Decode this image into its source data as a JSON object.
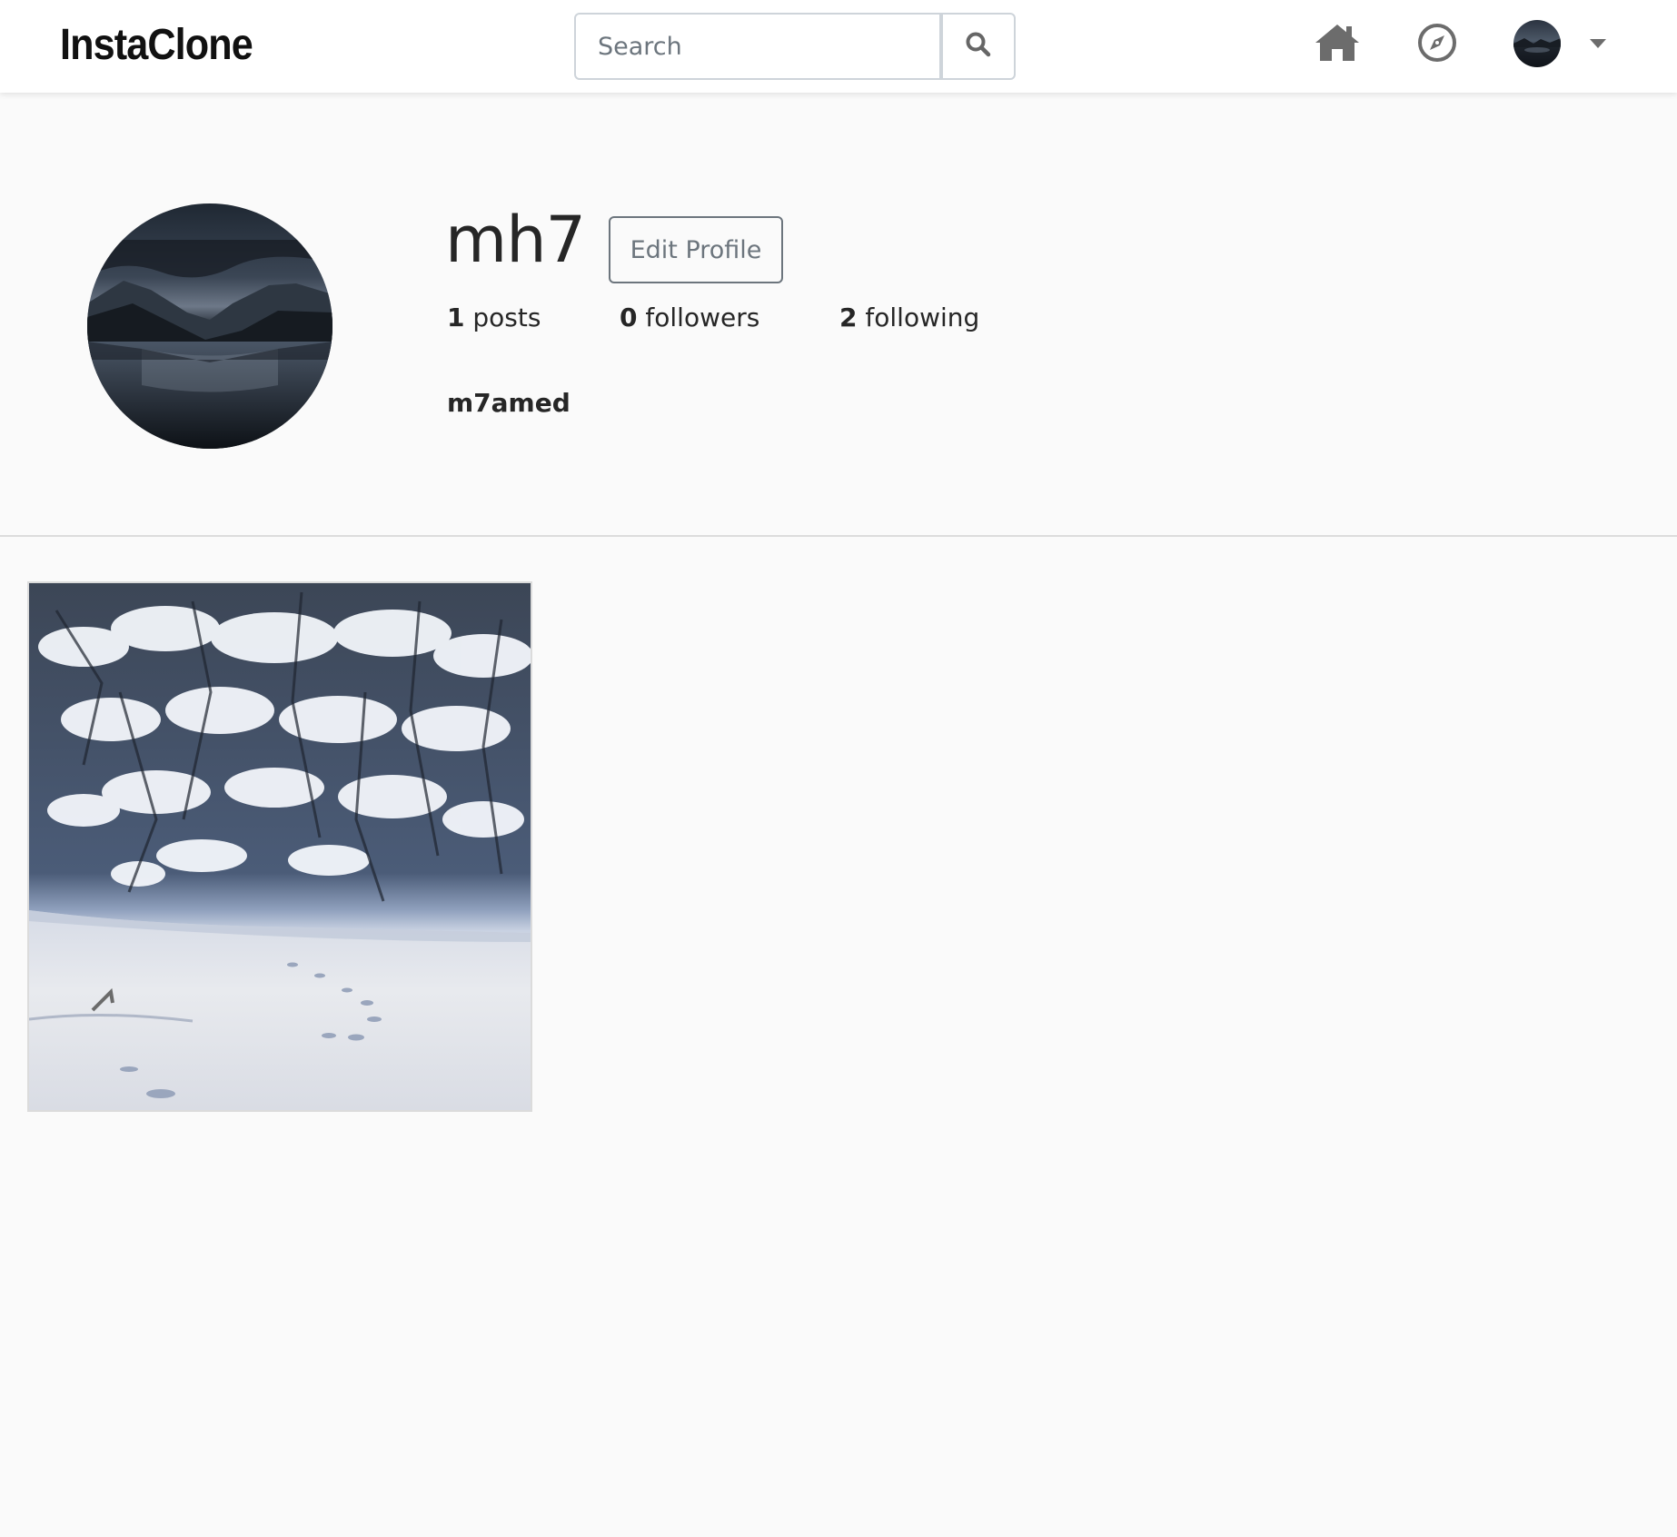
{
  "navbar": {
    "brand": "InstaClone",
    "search": {
      "placeholder": "Search",
      "value": ""
    },
    "icons": [
      "search-icon",
      "home-icon",
      "compass-icon",
      "chevron-down-icon"
    ]
  },
  "profile": {
    "username": "mh7",
    "edit_label": "Edit Profile",
    "stats": {
      "posts_count": "1",
      "posts_label": "posts",
      "followers_count": "0",
      "followers_label": "followers",
      "following_count": "2",
      "following_label": "following"
    },
    "full_name": "m7amed"
  },
  "colors": {
    "page_bg": "#fafafa",
    "navbar_bg": "#ffffff",
    "icon_gray": "#6c6c6c",
    "button_border": "#6c757d"
  }
}
